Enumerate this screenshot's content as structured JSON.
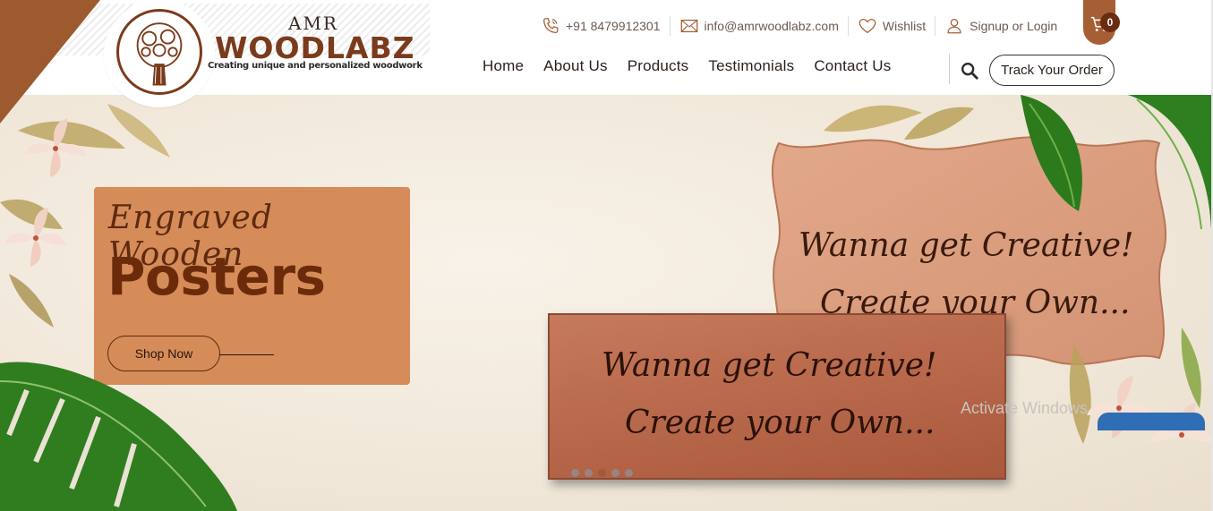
{
  "brand": {
    "name_small": "AMR",
    "name_big": "WOODLABZ",
    "tagline": "Creating unique and personalized woodwork"
  },
  "topbar": {
    "phone": "+91 8479912301",
    "email": "info@amrwoodlabz.com",
    "wishlist": "Wishlist",
    "account": "Signup or Login",
    "cart_count": "0"
  },
  "nav": {
    "items": [
      {
        "label": "Home"
      },
      {
        "label": "About Us"
      },
      {
        "label": "Products"
      },
      {
        "label": "Testimonials"
      },
      {
        "label": "Contact Us"
      }
    ],
    "track_order": "Track Your Order"
  },
  "hero": {
    "script_title": "Engraved Wooden",
    "title": "Posters",
    "cta": "Shop Now",
    "sign_back_line1": "Wanna get  Creative!",
    "sign_back_line2": "Create your Own...",
    "sign_front_line1": "Wanna get  Creative!",
    "sign_front_line2": "Create your Own...",
    "slides": 5,
    "active_slide": 3
  },
  "overlay": {
    "watermark": "Activate Windows"
  },
  "colors": {
    "brand_brown": "#7a3b1c",
    "accent_brown": "#a65f34",
    "card_orange": "#d58c58"
  }
}
